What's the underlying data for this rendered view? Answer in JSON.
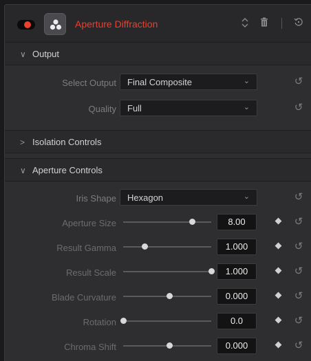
{
  "header": {
    "title": "Aperture Diffraction",
    "enabled": true,
    "accent_color": "#e8412e",
    "icons": [
      "toggle-switch",
      "resolve-fx-icon",
      "up-down-arrows-icon",
      "trash-icon",
      "reset-icon"
    ]
  },
  "sections": {
    "output": {
      "label": "Output",
      "expanded": true,
      "select_output": {
        "label": "Select Output",
        "value": "Final Composite"
      },
      "quality": {
        "label": "Quality",
        "value": "Full"
      }
    },
    "isolation": {
      "label": "Isolation Controls",
      "expanded": false
    },
    "aperture": {
      "label": "Aperture Controls",
      "expanded": true,
      "iris_shape": {
        "label": "Iris Shape",
        "value": "Hexagon"
      },
      "aperture_size": {
        "label": "Aperture Size",
        "value": "8.00",
        "slider_fraction": 0.78
      },
      "result_gamma": {
        "label": "Result Gamma",
        "value": "1.000",
        "slider_fraction": 0.24
      },
      "result_scale": {
        "label": "Result Scale",
        "value": "1.000",
        "slider_fraction": 1.0
      },
      "blade_curvature": {
        "label": "Blade Curvature",
        "value": "0.000",
        "slider_fraction": 0.52
      },
      "rotation": {
        "label": "Rotation",
        "value": "0.0",
        "slider_fraction": 0.0
      },
      "chroma_shift": {
        "label": "Chroma Shift",
        "value": "0.000",
        "slider_fraction": 0.52
      }
    }
  }
}
